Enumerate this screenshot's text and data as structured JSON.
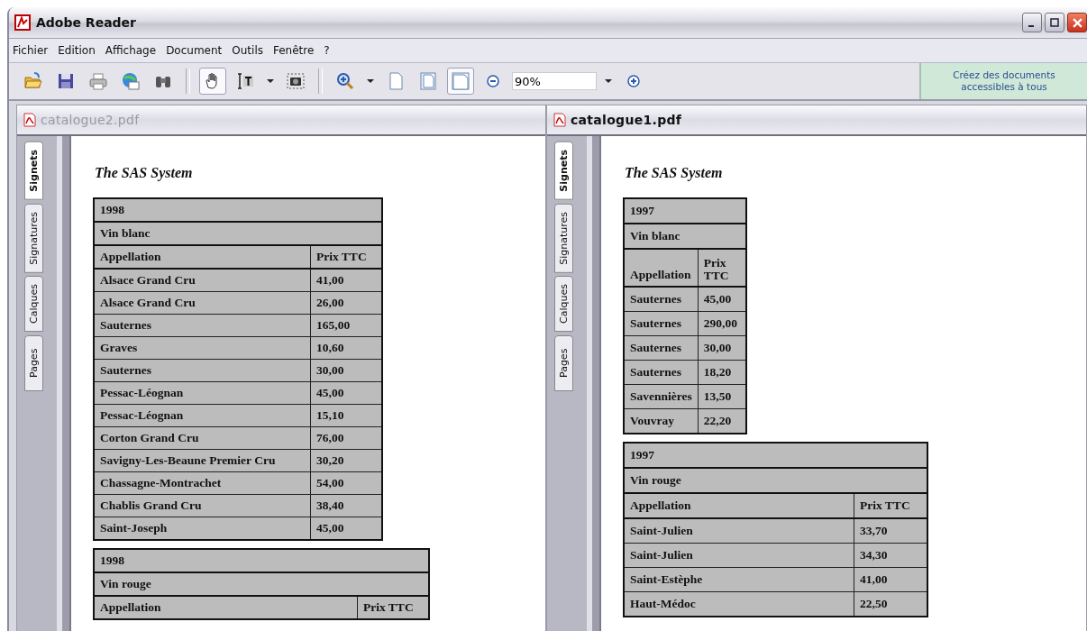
{
  "window": {
    "title": "Adobe Reader"
  },
  "menu": [
    "Fichier",
    "Edition",
    "Affichage",
    "Document",
    "Outils",
    "Fenêtre",
    "?"
  ],
  "toolbar": [
    {
      "kind": "open",
      "selected": false
    },
    {
      "kind": "save",
      "selected": false
    },
    {
      "kind": "print",
      "selected": false
    },
    {
      "kind": "email",
      "selected": false
    },
    {
      "kind": "find",
      "selected": false
    },
    {
      "kind": "sep"
    },
    {
      "kind": "hand",
      "selected": true
    },
    {
      "kind": "text",
      "selected": false
    },
    {
      "kind": "caret"
    },
    {
      "kind": "snapshot",
      "selected": false
    },
    {
      "kind": "sep"
    },
    {
      "kind": "zoomtool",
      "selected": false
    },
    {
      "kind": "caret"
    },
    {
      "kind": "actual",
      "selected": false
    },
    {
      "kind": "fitpage",
      "selected": false
    },
    {
      "kind": "fitwidth",
      "selected": true
    },
    {
      "kind": "zoomout",
      "selected": false
    },
    {
      "kind": "zoomfield",
      "value": "90%"
    },
    {
      "kind": "caret"
    },
    {
      "kind": "zoomin",
      "selected": false
    }
  ],
  "promo": "Créez des documents accessibles à tous",
  "documents": [
    {
      "title": "catalogue2.pdf",
      "active": false,
      "side_tabs": [
        {
          "label": "Signets",
          "selected": true
        },
        {
          "label": "Signatures",
          "selected": false
        },
        {
          "label": "Calques",
          "selected": false
        },
        {
          "label": "Pages",
          "selected": false
        }
      ],
      "heading": "The SAS System",
      "tables": [
        {
          "year": "1998",
          "category": "Vin blanc",
          "columns": [
            "Appellation",
            "Prix TTC"
          ],
          "rows": [
            [
              "Alsace Grand Cru",
              "41,00"
            ],
            [
              "Alsace Grand Cru",
              "26,00"
            ],
            [
              "Sauternes",
              "165,00"
            ],
            [
              "Graves",
              "10,60"
            ],
            [
              "Sauternes",
              "30,00"
            ],
            [
              "Pessac-Léognan",
              "45,00"
            ],
            [
              "Pessac-Léognan",
              "15,10"
            ],
            [
              "Corton Grand Cru",
              "76,00"
            ],
            [
              "Savigny-Les-Beaune Premier Cru",
              "30,20"
            ],
            [
              "Chassagne-Montrachet",
              "54,00"
            ],
            [
              "Chablis Grand Cru",
              "38,40"
            ],
            [
              "Saint-Joseph",
              "45,00"
            ]
          ]
        },
        {
          "year": "1998",
          "category": "Vin rouge",
          "columns": [
            "Appellation",
            "Prix TTC"
          ]
        }
      ]
    },
    {
      "title": "catalogue1.pdf",
      "active": true,
      "side_tabs": [
        {
          "label": "Signets",
          "selected": true
        },
        {
          "label": "Signatures",
          "selected": false
        },
        {
          "label": "Calques",
          "selected": false
        },
        {
          "label": "Pages",
          "selected": false
        }
      ],
      "heading": "The SAS System",
      "tables": [
        {
          "year": "1997",
          "category": "Vin blanc",
          "columns": [
            "Appellation",
            "Prix TTC"
          ],
          "rows": [
            [
              "Sauternes",
              "45,00"
            ],
            [
              "Sauternes",
              "290,00"
            ],
            [
              "Sauternes",
              "30,00"
            ],
            [
              "Sauternes",
              "18,20"
            ],
            [
              "Savennières",
              "13,50"
            ],
            [
              "Vouvray",
              "22,20"
            ]
          ]
        },
        {
          "year": "1997",
          "category": "Vin rouge",
          "columns": [
            "Appellation",
            "Prix TTC"
          ],
          "rows": [
            [
              "Saint-Julien",
              "33,70"
            ],
            [
              "Saint-Julien",
              "34,30"
            ],
            [
              "Saint-Estèphe",
              "41,00"
            ],
            [
              "Haut-Médoc",
              "22,50"
            ]
          ]
        }
      ]
    }
  ]
}
